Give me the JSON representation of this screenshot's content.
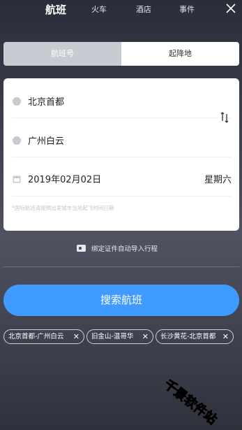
{
  "top_tabs": [
    {
      "label": "航班"
    },
    {
      "label": "火车"
    },
    {
      "label": "酒店"
    },
    {
      "label": "事件"
    }
  ],
  "mode_tabs": {
    "left": "航班号",
    "right": "起降地"
  },
  "from_city": "北京首都",
  "to_city": "广州白云",
  "date": "2019年02月02日",
  "weekday": "星期六",
  "note": "*国际航班请按照出发城市当地起飞时间日期",
  "bind_label": "绑定证件自动导入行程",
  "search_label": "搜索航班",
  "history": [
    {
      "label": "北京首都-广州白云"
    },
    {
      "label": "旧金山-温哥华"
    },
    {
      "label": "长沙黄花-北京首都"
    }
  ],
  "watermark": "千景软件站",
  "colors": {
    "accent": "#3f9bff",
    "segment_inactive": "#c9cbd2"
  }
}
